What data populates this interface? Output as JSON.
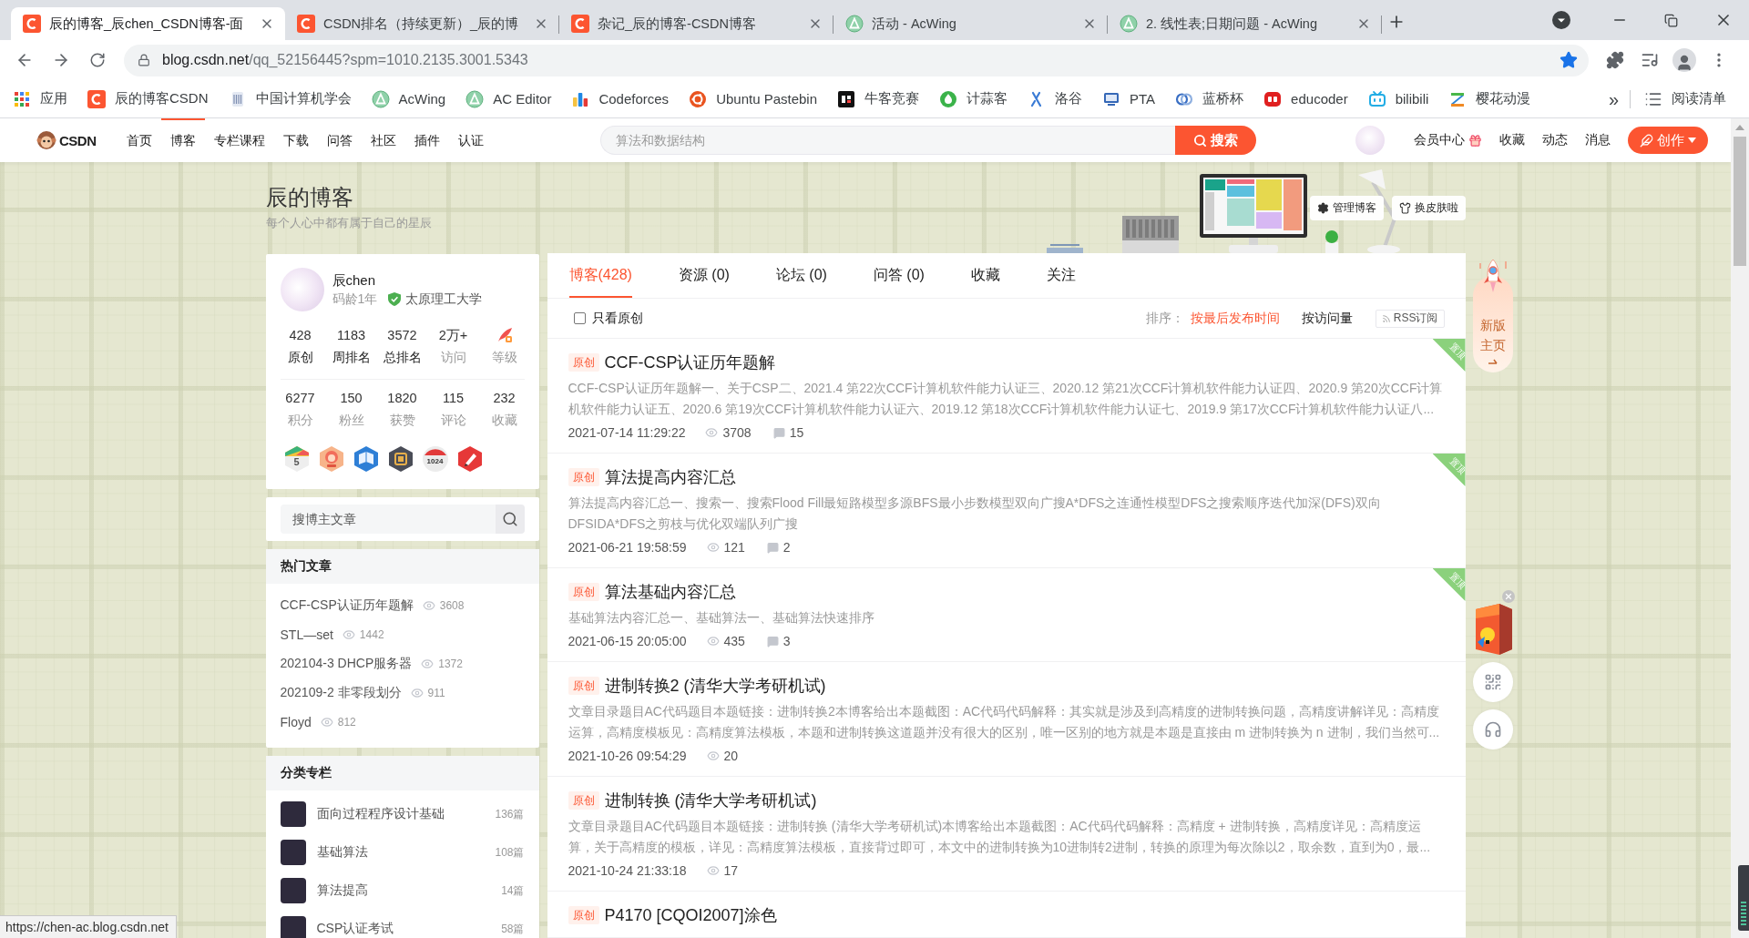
{
  "browser": {
    "tabs": [
      {
        "kind": "csdn",
        "title": "辰的博客_辰chen_CSDN博客-面",
        "selected": true
      },
      {
        "kind": "csdn",
        "title": "CSDN排名（持续更新）_辰的博",
        "selected": false
      },
      {
        "kind": "csdn",
        "title": "杂记_辰的博客-CSDN博客",
        "selected": false
      },
      {
        "kind": "acwing",
        "title": "活动 - AcWing",
        "selected": false
      },
      {
        "kind": "acwing",
        "title": "2. 线性表;日期问题 - AcWing",
        "selected": false
      }
    ],
    "address": {
      "host": "blog.csdn.net",
      "path": "/qq_52156445?spm=1010.2135.3001.5343",
      "starred": true
    },
    "bookmarks": [
      {
        "kind": "apps",
        "label": "应用"
      },
      {
        "kind": "csdn",
        "label": "辰的博客CSDN"
      },
      {
        "kind": "ccf",
        "label": "中国计算机学会"
      },
      {
        "kind": "acwing",
        "label": "AcWing"
      },
      {
        "kind": "acwing",
        "label": "AC Editor"
      },
      {
        "kind": "codeforces",
        "label": "Codeforces"
      },
      {
        "kind": "ubuntu",
        "label": "Ubuntu Pastebin"
      },
      {
        "kind": "nowcoder",
        "label": "牛客竞赛"
      },
      {
        "kind": "jisuanke",
        "label": "计蒜客"
      },
      {
        "kind": "luogu",
        "label": "洛谷"
      },
      {
        "kind": "pta",
        "label": "PTA"
      },
      {
        "kind": "lanqiao",
        "label": "蓝桥杯"
      },
      {
        "kind": "educoder",
        "label": "educoder"
      },
      {
        "kind": "bilibili",
        "label": "bilibili"
      },
      {
        "kind": "yhdm",
        "label": "樱花动漫"
      }
    ],
    "bookmarks_overflow": "»",
    "reading_list": {
      "kind": "reading",
      "label": "阅读清单"
    }
  },
  "site_nav": {
    "logo": "CSDN",
    "items": [
      {
        "label": "首页",
        "selected": false
      },
      {
        "label": "博客",
        "selected": true
      },
      {
        "label": "专栏课程",
        "selected": false
      },
      {
        "label": "下载",
        "selected": false
      },
      {
        "label": "问答",
        "selected": false
      },
      {
        "label": "社区",
        "selected": false
      },
      {
        "label": "插件",
        "selected": false
      },
      {
        "label": "认证",
        "selected": false
      }
    ],
    "search": {
      "placeholder": "算法和数据结构",
      "button": "搜索"
    },
    "links": [
      {
        "kind": "vip",
        "label": "会员中心"
      },
      {
        "kind": "plain",
        "label": "收藏"
      },
      {
        "kind": "plain",
        "label": "动态"
      },
      {
        "kind": "plain",
        "label": "消息"
      }
    ],
    "create_button": "创作"
  },
  "blog_header": {
    "title": "辰的博客",
    "subtitle": "每个人心中都有属于自己的星辰",
    "buttons": [
      {
        "kind": "manage",
        "label": "管理博客"
      },
      {
        "kind": "skin",
        "label": "换皮肤啦"
      }
    ]
  },
  "profile": {
    "name": "辰chen",
    "code_age": "码龄1年",
    "school": "太原理工大学",
    "stat_rows": [
      [
        {
          "kind": "link",
          "value": "428",
          "label": "原创"
        },
        {
          "kind": "link",
          "value": "1183",
          "label": "周排名"
        },
        {
          "kind": "link",
          "value": "3572",
          "label": "总排名"
        },
        {
          "kind": "plain",
          "value": "2万+",
          "label": "访问"
        },
        {
          "kind": "level",
          "label": "等级"
        }
      ],
      [
        {
          "kind": "plain",
          "value": "6277",
          "label": "积分"
        },
        {
          "kind": "plain",
          "value": "150",
          "label": "粉丝"
        },
        {
          "kind": "plain",
          "value": "1820",
          "label": "获赞"
        },
        {
          "kind": "plain",
          "value": "115",
          "label": "评论"
        },
        {
          "kind": "plain",
          "value": "232",
          "label": "收藏"
        }
      ]
    ],
    "badges": [
      {
        "kind": "checkin",
        "label": "5"
      },
      {
        "kind": "anniversary"
      },
      {
        "kind": "book"
      },
      {
        "kind": "medal"
      },
      {
        "kind": "calendar",
        "label": "1024"
      },
      {
        "kind": "pen"
      }
    ]
  },
  "blog_search": {
    "placeholder": "搜博主文章"
  },
  "hot_articles": {
    "title": "热门文章",
    "items": [
      {
        "title": "CCF-CSP认证历年题解",
        "views": "3608"
      },
      {
        "title": "STL—set",
        "views": "1442"
      },
      {
        "title": "202104-3 DHCP服务器",
        "views": "1372"
      },
      {
        "title": "202109-2 非零段划分",
        "views": "911"
      },
      {
        "title": "Floyd",
        "views": "812"
      }
    ]
  },
  "categories": {
    "title": "分类专栏",
    "items": [
      {
        "name": "面向过程程序设计基础",
        "count": "136篇"
      },
      {
        "name": "基础算法",
        "count": "108篇"
      },
      {
        "name": "算法提高",
        "count": "14篇"
      },
      {
        "name": "CSP认证考试",
        "count": "58篇"
      }
    ]
  },
  "content_tabs": [
    {
      "label": "博客(428)",
      "selected": true
    },
    {
      "label": "资源 (0)",
      "selected": false
    },
    {
      "label": "论坛 (0)",
      "selected": false
    },
    {
      "label": "问答 (0)",
      "selected": false
    },
    {
      "label": "收藏",
      "selected": false
    },
    {
      "label": "关注",
      "selected": false
    }
  ],
  "filter": {
    "original_only": {
      "label": "只看原创",
      "checked": false
    },
    "sort_label": "排序：",
    "sort_options": [
      {
        "label": "按最后发布时间",
        "selected": true
      },
      {
        "label": "按访问量",
        "selected": false
      }
    ],
    "rss": "RSS订阅"
  },
  "articles": [
    {
      "tag": "原创",
      "title": "CCF-CSP认证历年题解",
      "summary": "CCF-CSP认证历年题解一、关于CSP二、2021.4 第22次CCF计算机软件能力认证三、2020.12 第21次CCF计算机软件能力认证四、2020.9 第20次CCF计算机软件能力认证五、2020.6 第19次CCF计算机软件能力认证六、2019.12 第18次CCF计算机软件能力认证七、2019.9 第17次CCF计算机软件能力认证八...",
      "date": "2021-07-14 11:29:22",
      "views": "3708",
      "comments": "15",
      "pinned": true,
      "ribbon": "置顶"
    },
    {
      "tag": "原创",
      "title": "算法提高内容汇总",
      "summary": "算法提高内容汇总一、搜索一、搜索Flood Fill最短路模型多源BFS最小步数模型双向广搜A*DFS之连通性模型DFS之搜索顺序迭代加深(DFS)双向DFSIDA*DFS之剪枝与优化双端队列广搜",
      "date": "2021-06-21 19:58:59",
      "views": "121",
      "comments": "2",
      "pinned": true,
      "ribbon": "置顶"
    },
    {
      "tag": "原创",
      "title": "算法基础内容汇总",
      "summary": "基础算法内容汇总一、基础算法一、基础算法快速排序",
      "date": "2021-06-15 20:05:00",
      "views": "435",
      "comments": "3",
      "pinned": true,
      "ribbon": "置顶"
    },
    {
      "tag": "原创",
      "title": "进制转换2 (清华大学考研机试)",
      "summary": "文章目录题目AC代码题目本题链接：进制转换2本博客给出本题截图：AC代码代码解释：其实就是涉及到高精度的进制转换问题，高精度讲解详见：高精度运算，高精度模板见：高精度算法模板，本题和进制转换这道题并没有很大的区别，唯一区别的地方就是本题是直接由 m 进制转换为 n 进制，我们当然可...",
      "date": "2021-10-26 09:54:29",
      "views": "20",
      "pinned": false
    },
    {
      "tag": "原创",
      "title": "进制转换 (清华大学考研机试)",
      "summary": "文章目录题目AC代码题目本题链接：进制转换 (清华大学考研机试)本博客给出本题截图：AC代码代码解释：高精度 + 进制转换，高精度详见：高精度运算，关于高精度的模板，详见：高精度算法模板，直接背过即可，本文中的进制转换为10进制转2进制，转换的原理为每次除以2，取余数，直到为0，最...",
      "date": "2021-10-24 21:33:18",
      "views": "17",
      "pinned": false
    },
    {
      "tag": "原创",
      "title": "P4170 [CQOI2007]涂色",
      "pinned": false
    }
  ],
  "side_tools": {
    "new_home": "新版主页"
  },
  "status_url": "https://chen-ac.blog.csdn.net"
}
